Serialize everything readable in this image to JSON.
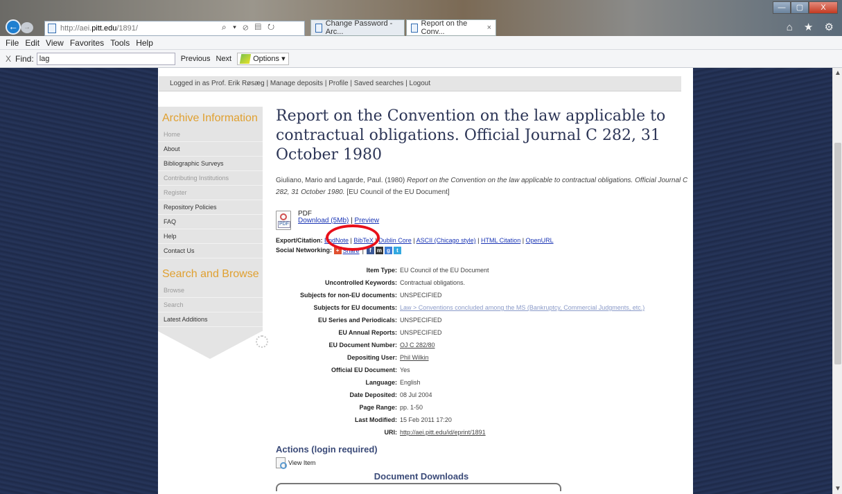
{
  "browser": {
    "url_prefix": "http://aei.",
    "url_domain": "pitt.edu",
    "url_suffix": "/1891/",
    "address_tools": "⌕ ▾ ⊘ ▤ ↻",
    "tabs": [
      {
        "label": "Change Password - Arc..."
      },
      {
        "label": "Report on the Conv..."
      }
    ],
    "tab_close": "×",
    "window_buttons": [
      "—",
      "▢",
      "X"
    ],
    "right_icons": "⌂ ★ ⚙"
  },
  "menubar": {
    "items": [
      "File",
      "Edit",
      "View",
      "Favorites",
      "Tools",
      "Help"
    ]
  },
  "findbar": {
    "close": "X",
    "label": "Find:",
    "query": "lag",
    "previous": "Previous",
    "next": "Next",
    "options": "Options ▾"
  },
  "loginbar": {
    "text": "Logged in as Prof. Erik Røsæg | Manage deposits | Profile | Saved searches | Logout"
  },
  "sidebar": {
    "archive_heading": "Archive Information",
    "archive_items": [
      {
        "label": "Home",
        "dim": true
      },
      {
        "label": "About",
        "dim": false
      },
      {
        "label": "Bibliographic Surveys",
        "dim": false
      },
      {
        "label": "Contributing Institutions",
        "dim": true
      },
      {
        "label": "Register",
        "dim": true
      },
      {
        "label": "Repository Policies",
        "dim": false
      },
      {
        "label": "FAQ",
        "dim": false
      },
      {
        "label": "Help",
        "dim": false
      },
      {
        "label": "Contact Us",
        "dim": false
      }
    ],
    "search_heading": "Search and Browse",
    "search_items": [
      {
        "label": "Browse",
        "dim": true
      },
      {
        "label": "Search",
        "dim": true
      },
      {
        "label": "Latest Additions",
        "dim": false
      }
    ]
  },
  "document": {
    "title": "Report on the Convention on the law applicable to contractual obligations. Official Journal C 282, 31 October 1980",
    "authors": "Giuliano, Mario and Lagarde, Paul. (1980) ",
    "cite_title": "Report on the Convention on the law applicable to contractual obligations. Official Journal C 282, 31 October 1980.",
    "cite_type": " [EU Council of the EU Document]",
    "pdf_label": "PDF",
    "pdf_icon_label": "PDF",
    "download": "Download (5Mb)",
    "sep": " | ",
    "preview": "Preview"
  },
  "export": {
    "label": "Export/Citation:",
    "links": [
      "EndNote",
      "BibTeX",
      "Dublin Core",
      "ASCII (Chicago style)",
      "HTML Citation",
      "OpenURL"
    ]
  },
  "social": {
    "label": "Social Networking:",
    "share": "Share",
    "sep": "|"
  },
  "metadata": [
    {
      "key": "Item Type:",
      "value": "EU Council of the EU Document",
      "link": false
    },
    {
      "key": "Uncontrolled Keywords:",
      "value": "Contractual obligations.",
      "link": false
    },
    {
      "key": "Subjects for non-EU documents:",
      "value": "UNSPECIFIED",
      "link": false
    },
    {
      "key": "Subjects for EU documents:",
      "value": "Law > Conventions concluded among the MS (Bankruptcy, Commercial Judgments, etc.)",
      "link": "light"
    },
    {
      "key": "EU Series and Periodicals:",
      "value": "UNSPECIFIED",
      "link": false
    },
    {
      "key": "EU Annual Reports:",
      "value": "UNSPECIFIED",
      "link": false
    },
    {
      "key": "EU Document Number:",
      "value": "OJ C 282/80",
      "link": true
    },
    {
      "key": "Depositing User:",
      "value": "Phil Wilkin",
      "link": true
    },
    {
      "key": "Official EU Document:",
      "value": "Yes",
      "link": false
    },
    {
      "key": "Language:",
      "value": "English",
      "link": false
    },
    {
      "key": "Date Deposited:",
      "value": "08 Jul 2004",
      "link": false
    },
    {
      "key": "Page Range:",
      "value": "pp. 1-50",
      "link": false
    },
    {
      "key": "Last Modified:",
      "value": "15 Feb 2011 17:20",
      "link": false
    },
    {
      "key": "URI:",
      "value": "http://aei.pitt.edu/id/eprint/1891",
      "link": true
    }
  ],
  "actions": {
    "heading": "Actions (login required)",
    "view_item": "View Item",
    "downloads_heading": "Document Downloads"
  },
  "colors": {
    "annotation_circle": "#e8101a",
    "sidebar_heading": "#e0a030",
    "link": "#1a35b5",
    "title": "#2c3556"
  }
}
